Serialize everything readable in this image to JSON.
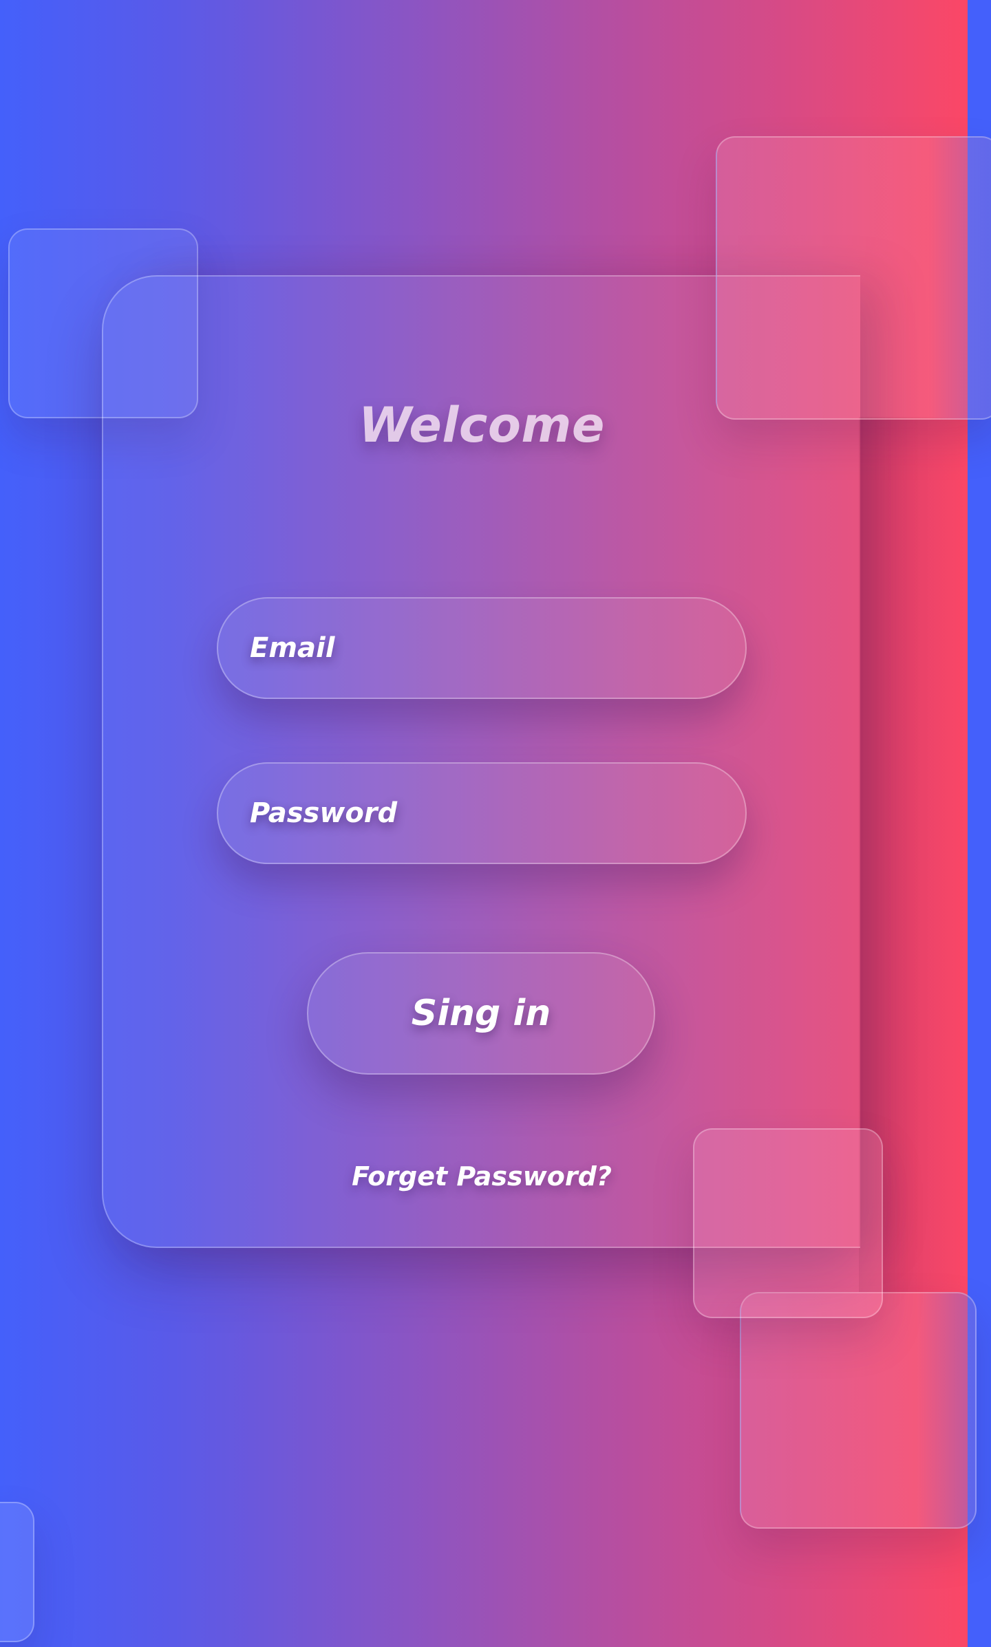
{
  "colors": {
    "gradient_start": "#4460fb",
    "gradient_end": "#fb4766",
    "text": "#ffffff"
  },
  "login": {
    "title": "Welcome",
    "email_placeholder": "Email",
    "password_placeholder": "Password",
    "signin_label": "Sing in",
    "forgot_label": "Forget Password?"
  }
}
